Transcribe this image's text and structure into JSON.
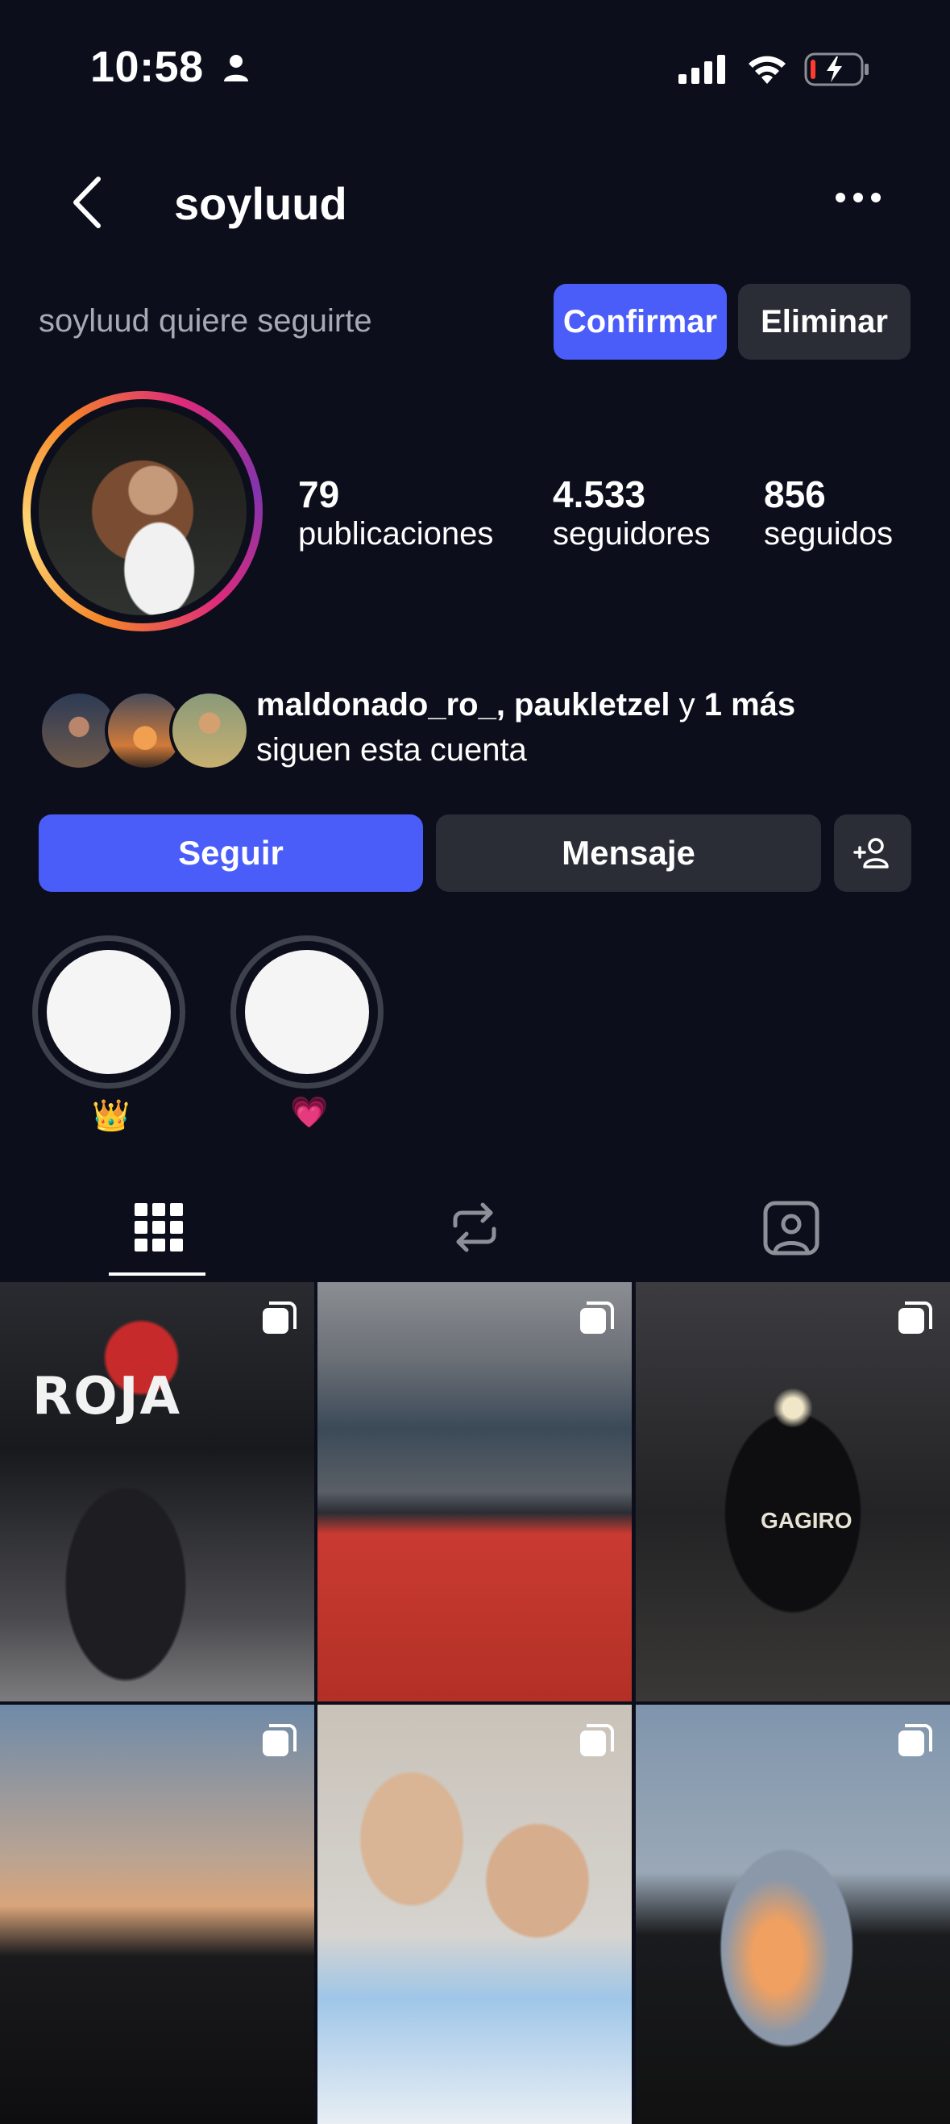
{
  "status_bar": {
    "time": "10:58"
  },
  "header": {
    "username": "soyluud"
  },
  "follow_request": {
    "text": "soyluud quiere seguirte",
    "confirm_label": "Confirmar",
    "delete_label": "Eliminar"
  },
  "stats": [
    {
      "value": "79",
      "label": "publicaciones"
    },
    {
      "value": "4.533",
      "label": "seguidores"
    },
    {
      "value": "856",
      "label": "seguidos"
    }
  ],
  "mutual": {
    "names": "maldonado_ro_, paukletzel",
    "connector": "y",
    "more": "1 más",
    "subtitle": "siguen esta cuenta"
  },
  "actions": {
    "follow_label": "Seguir",
    "message_label": "Mensaje"
  },
  "highlights": [
    {
      "label": "👑"
    },
    {
      "label": "💗"
    }
  ],
  "tabs": [
    {
      "icon": "grid-icon",
      "active": true
    },
    {
      "icon": "reposts-icon",
      "active": false
    },
    {
      "icon": "tagged-icon",
      "active": false
    }
  ],
  "grid": {
    "tile_text_1": "ROJA",
    "tile_text_3": "GAGIRO"
  },
  "colors": {
    "background": "#0c0f1b",
    "primary_button": "#4a5df9",
    "secondary_button": "#2a2d36"
  }
}
